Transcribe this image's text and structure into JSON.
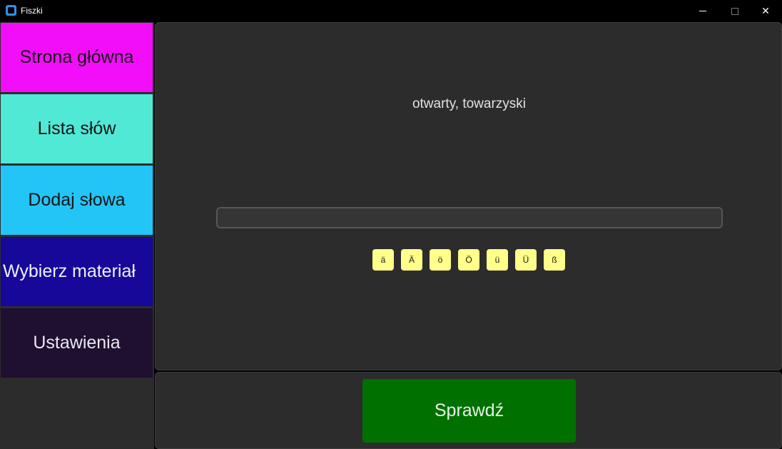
{
  "window": {
    "title": "Fiszki",
    "icons": {
      "app": "app-icon",
      "minimize": "minimize-icon",
      "maximize": "maximize-icon",
      "close": "close-icon"
    },
    "close_glyph": "✕"
  },
  "sidebar": {
    "items": [
      {
        "label": "Strona główna",
        "color": "#f20ef9"
      },
      {
        "label": "Lista słów",
        "color": "#50e9d6"
      },
      {
        "label": "Dodaj słowa",
        "color": "#23c5f7"
      },
      {
        "label": "Wybierz materiał",
        "color": "#160898"
      },
      {
        "label": "Ustawienia",
        "color": "#1f0f31"
      }
    ]
  },
  "quiz": {
    "prompt": "otwarty, towarzyski",
    "answer_value": "",
    "special_chars": [
      "ä",
      "Ä",
      "ö",
      "Ö",
      "ü",
      "Ü",
      "ß"
    ]
  },
  "footer": {
    "check_label": "Sprawdź",
    "check_color": "#007000"
  }
}
